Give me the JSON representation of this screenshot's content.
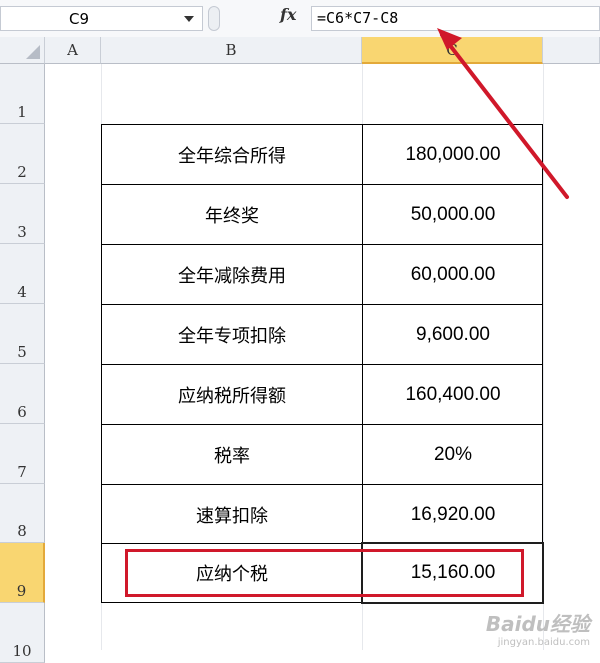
{
  "formula_bar": {
    "name_box": "C9",
    "fx_label": "fx",
    "formula": "=C6*C7-C8"
  },
  "columns": [
    "A",
    "B",
    "C"
  ],
  "rows": [
    "1",
    "2",
    "3",
    "4",
    "5",
    "6",
    "7",
    "8",
    "9",
    "10"
  ],
  "table": [
    {
      "label": "全年综合所得",
      "value": "180,000.00"
    },
    {
      "label": "年终奖",
      "value": "50,000.00"
    },
    {
      "label": "全年减除费用",
      "value": "60,000.00"
    },
    {
      "label": "全年专项扣除",
      "value": "9,600.00"
    },
    {
      "label": "应纳税所得额",
      "value": "160,400.00"
    },
    {
      "label": "税率",
      "value": "20%"
    },
    {
      "label": "速算扣除",
      "value": "16,920.00"
    },
    {
      "label": "应纳个税",
      "value": "15,160.00"
    }
  ],
  "selected_cell": "C9",
  "colors": {
    "highlight_box": "#d0182a",
    "arrow": "#d0182a",
    "selected_header": "#f9d671"
  },
  "watermark": {
    "brand": "Baidu经验",
    "url": "jingyan.baidu.com"
  }
}
